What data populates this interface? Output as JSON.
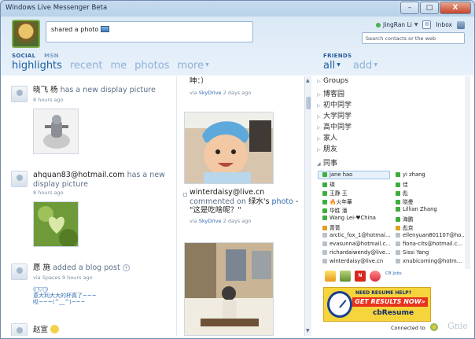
{
  "window": {
    "title": "Windows Live Messenger Beta",
    "controls": [
      "–",
      "□",
      "X"
    ]
  },
  "status": {
    "text": "shared a photo"
  },
  "user": {
    "name": "JingRan Li",
    "inbox_label": "Inbox"
  },
  "search": {
    "placeholder": "Search contacts or the web"
  },
  "social_tabs": {
    "social": "SOCIAL",
    "msn": "MSN"
  },
  "nav": [
    "highlights",
    "recent",
    "me",
    "photos",
    "more"
  ],
  "friends_header": {
    "title": "FRIENDS",
    "all": "all",
    "add": "add"
  },
  "feed_left": [
    {
      "name": "晓飞 杨",
      "verb": "has a new display picture",
      "time": "8 hours ago"
    },
    {
      "name": "ahquan83@hotmail.com",
      "verb": "has a new",
      "verb2": "display picture",
      "time": "8 hours ago"
    },
    {
      "name": "愿 施",
      "verb": "added a blog post",
      "time": "via Spaces 9 hours ago",
      "blog_line1": "(ﾟ▽ﾟ)",
      "blog_line2": "意大利大大的杯真了~~~",
      "blog_line3": "哎~~~(^__^)~~~"
    },
    {
      "name": "赵宣"
    }
  ],
  "feed_right": [
    {
      "snippet": "呻：）",
      "via": "via",
      "source": "SkyDrive",
      "time": "2 days ago"
    },
    {
      "name": "winterdaisy@live.cn",
      "commented": "commented on",
      "owner": "绿水",
      "possessive": "'s",
      "photo": "photo",
      "dash": "-",
      "quote": "\"这是吃啥呢？\"",
      "via": "via",
      "source": "SkyDrive",
      "time": "2 days ago"
    }
  ],
  "groups": [
    "Groups",
    "博客园",
    "初中同学",
    "大学同学",
    "高中同学",
    "家人",
    "朋友",
    "同事"
  ],
  "contacts_left": [
    "jane hao",
    "瑛",
    "王静 王",
    "🔥火年華",
    "华胜 潘",
    "Wang Lei-♥China",
    "菁菁",
    "arctic_fox_1@hotmai...",
    "evasunna@hotmail.c...",
    "richardaiwendy@live...",
    "winterdaisy@live.cn"
  ],
  "contacts_right": [
    "yi zhang",
    "佳",
    "彪",
    "晓曼",
    "Lillian Zhang",
    "海鹏",
    "彪京",
    "ellenyuan801107@ho...",
    "fiona-cits@hotmail.c...",
    "Sissi Yang",
    "xnubicorning@hotm..."
  ],
  "contact_colors_left": [
    "#3cae3c",
    "#3cae3c",
    "#3cae3c",
    "#3cae3c",
    "#3cae3c",
    "#3cae3c",
    "#e0a020",
    "#b8c0c8",
    "#b8c0c8",
    "#b8c0c8",
    "#b8c0c8"
  ],
  "contact_colors_right": [
    "#3cae3c",
    "#3cae3c",
    "#3cae3c",
    "#3cae3c",
    "#3cae3c",
    "#3cae3c",
    "#e0a020",
    "#b8c0c8",
    "#b8c0c8",
    "#b8c0c8",
    "#b8c0c8"
  ],
  "apps": [
    "N",
    "CB Jobs"
  ],
  "ad": {
    "top": "NEED RESUME HELP?",
    "mid": "GET RESULTS NOW»",
    "brand": "cbResume"
  },
  "statusbar": {
    "connected": "Connected to",
    "watermark": "Gnie"
  }
}
